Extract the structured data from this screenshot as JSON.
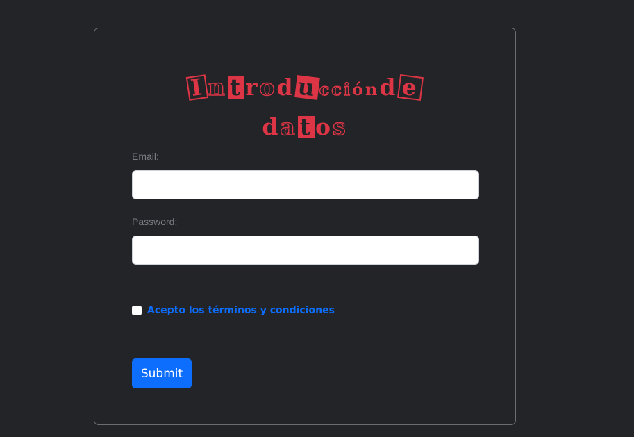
{
  "form": {
    "title_line1": [
      "I",
      "n",
      "t",
      "r",
      "o",
      "d",
      "u",
      "c",
      "c",
      "i",
      "ó",
      "n",
      " ",
      "d",
      "e"
    ],
    "title_line2": [
      "d",
      "a",
      "t",
      "o",
      "s"
    ],
    "email_label": "Email:",
    "email_value": "",
    "password_label": "Password:",
    "password_value": "",
    "terms_label": "Acepto los términos y condiciones",
    "terms_checked": false,
    "submit_label": "Submit"
  },
  "colors": {
    "background": "#232428",
    "title": "#dc3545",
    "link": "#0d6efd",
    "button": "#0d6efd",
    "label": "#7b7d83"
  }
}
